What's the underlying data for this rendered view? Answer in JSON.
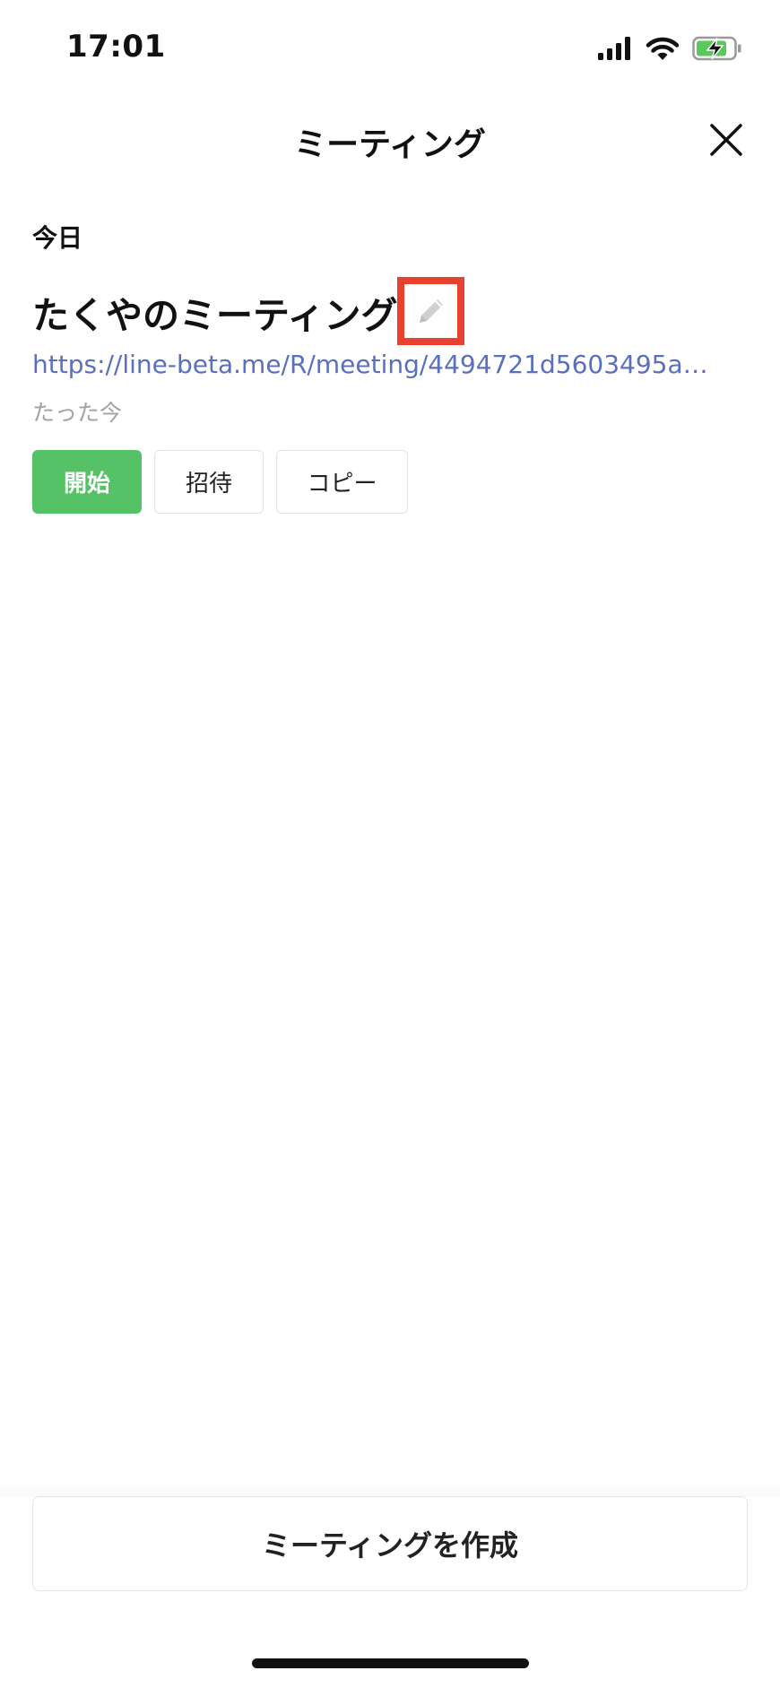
{
  "status_bar": {
    "time": "17:01",
    "icons": [
      "cellular-signal-icon",
      "wifi-icon",
      "battery-charging-icon"
    ]
  },
  "header": {
    "title": "ミーティング",
    "close_icon": "close-icon"
  },
  "section": {
    "label": "今日"
  },
  "meeting": {
    "title": "たくやのミーティング",
    "edit_icon": "pencil-icon",
    "url": "https://line-beta.me/R/meeting/4494721d5603495a9...",
    "time": "たった今"
  },
  "actions": {
    "start_label": "開始",
    "invite_label": "招待",
    "copy_label": "コピー"
  },
  "footer": {
    "create_label": "ミーティングを作成"
  },
  "colors": {
    "accent_green": "#55c268",
    "link_blue": "#5a6fbd",
    "highlight_red": "#e8412d",
    "battery_green": "#5ac85a"
  }
}
